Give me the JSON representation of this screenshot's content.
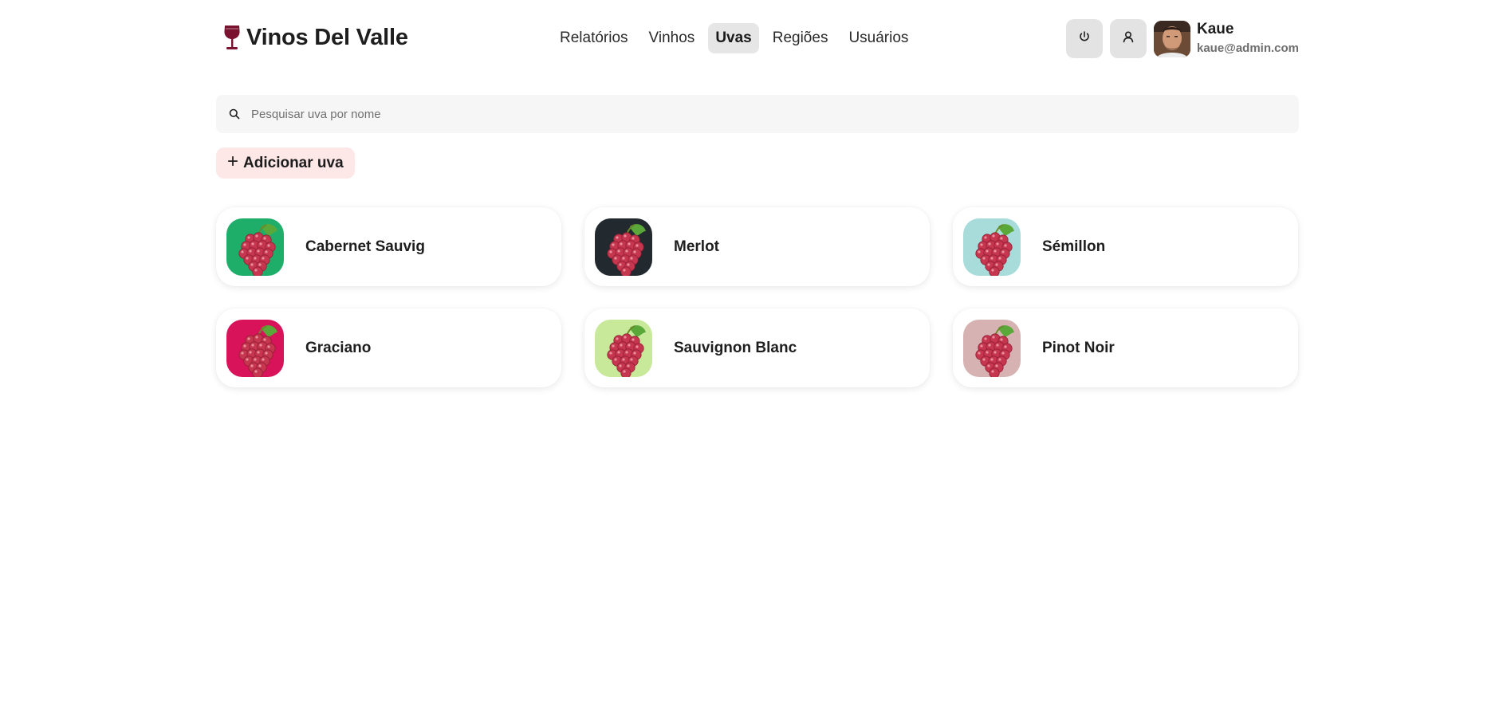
{
  "brand": {
    "title": "Vinos Del Valle",
    "icon": "wine-glass-icon",
    "icon_color": "#7a1230"
  },
  "nav": {
    "items": [
      {
        "label": "Relatórios",
        "active": false
      },
      {
        "label": "Vinhos",
        "active": false
      },
      {
        "label": "Uvas",
        "active": true
      },
      {
        "label": "Regiões",
        "active": false
      },
      {
        "label": "Usuários",
        "active": false
      }
    ]
  },
  "actions": {
    "power_icon": "power-icon",
    "user_icon": "user-icon"
  },
  "user": {
    "name": "Kaue",
    "email": "kaue@admin.com"
  },
  "search": {
    "placeholder": "Pesquisar uva por nome",
    "value": "",
    "icon": "search-icon"
  },
  "add_button": {
    "icon": "plus-icon",
    "label": "Adicionar uva",
    "bg_color": "#fde7e7"
  },
  "grapes": [
    {
      "name": "Cabernet Sauvig",
      "bg_color": "#1fae6a",
      "icon": "grapes-icon"
    },
    {
      "name": "Merlot",
      "bg_color": "#22292f",
      "icon": "grapes-icon"
    },
    {
      "name": "Sémillon",
      "bg_color": "#a7dcdb",
      "icon": "grapes-icon"
    },
    {
      "name": "Graciano",
      "bg_color": "#d8135a",
      "icon": "grapes-icon"
    },
    {
      "name": "Sauvignon Blanc",
      "bg_color": "#c8e89a",
      "icon": "grapes-icon"
    },
    {
      "name": "Pinot Noir",
      "bg_color": "#d7b2b2",
      "icon": "grapes-icon"
    }
  ]
}
